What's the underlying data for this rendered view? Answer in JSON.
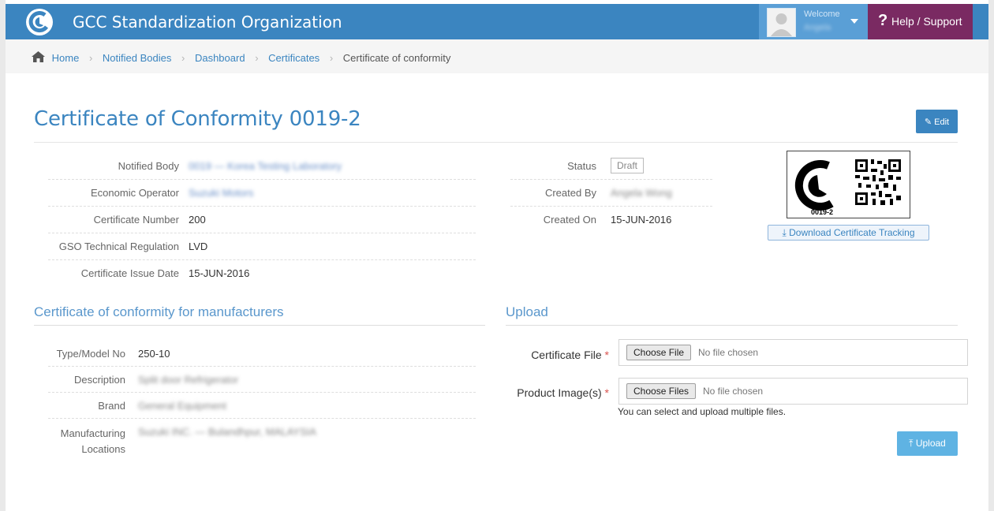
{
  "header": {
    "app_title": "GCC Standardization Organization",
    "welcome": "Welcome",
    "user_name": "Angela",
    "help_label": "Help / Support"
  },
  "breadcrumb": [
    "Home",
    "Notified Bodies",
    "Dashboard",
    "Certificates",
    "Certificate of conformity"
  ],
  "page": {
    "title": "Certificate of Conformity 0019-2",
    "edit_label": "Edit"
  },
  "details": {
    "notified_body": {
      "label": "Notified Body",
      "value": "0019 — Korea Testing Laboratory"
    },
    "economic_operator": {
      "label": "Economic Operator",
      "value": "Suzuki Motors"
    },
    "certificate_number": {
      "label": "Certificate Number",
      "value": "200"
    },
    "technical_regulation": {
      "label": "GSO Technical Regulation",
      "value": "LVD"
    },
    "issue_date": {
      "label": "Certificate Issue Date",
      "value": "15-JUN-2016"
    }
  },
  "meta": {
    "status": {
      "label": "Status",
      "value": "Draft"
    },
    "created_by": {
      "label": "Created By",
      "value": "Angela Wong"
    },
    "created_on": {
      "label": "Created On",
      "value": "15-JUN-2016"
    }
  },
  "tracking": {
    "code": "0019-2",
    "download_label": "Download Certificate Tracking"
  },
  "manufacturers": {
    "section_title": "Certificate of conformity for manufacturers",
    "type_model": {
      "label": "Type/Model No",
      "value": "250-10"
    },
    "description": {
      "label": "Description",
      "value": "Split door Refrigerator"
    },
    "brand": {
      "label": "Brand",
      "value": "General Equipment"
    },
    "locations": {
      "label_line1": "Manufacturing",
      "label_line2": "Locations",
      "value": "Suzuki INC. — Bulandhpur, MALAYSIA"
    }
  },
  "upload": {
    "section_title": "Upload",
    "certificate_file": {
      "label": "Certificate File",
      "button": "Choose File",
      "none": "No file chosen"
    },
    "product_images": {
      "label": "Product Image(s)",
      "button": "Choose Files",
      "none": "No file chosen"
    },
    "required_mark": "*",
    "helper": "You can select and upload multiple files.",
    "upload_label": "Upload"
  },
  "colors": {
    "primary": "#3b85c0",
    "help_bg": "#7a2a62",
    "required": "#d9534f"
  }
}
